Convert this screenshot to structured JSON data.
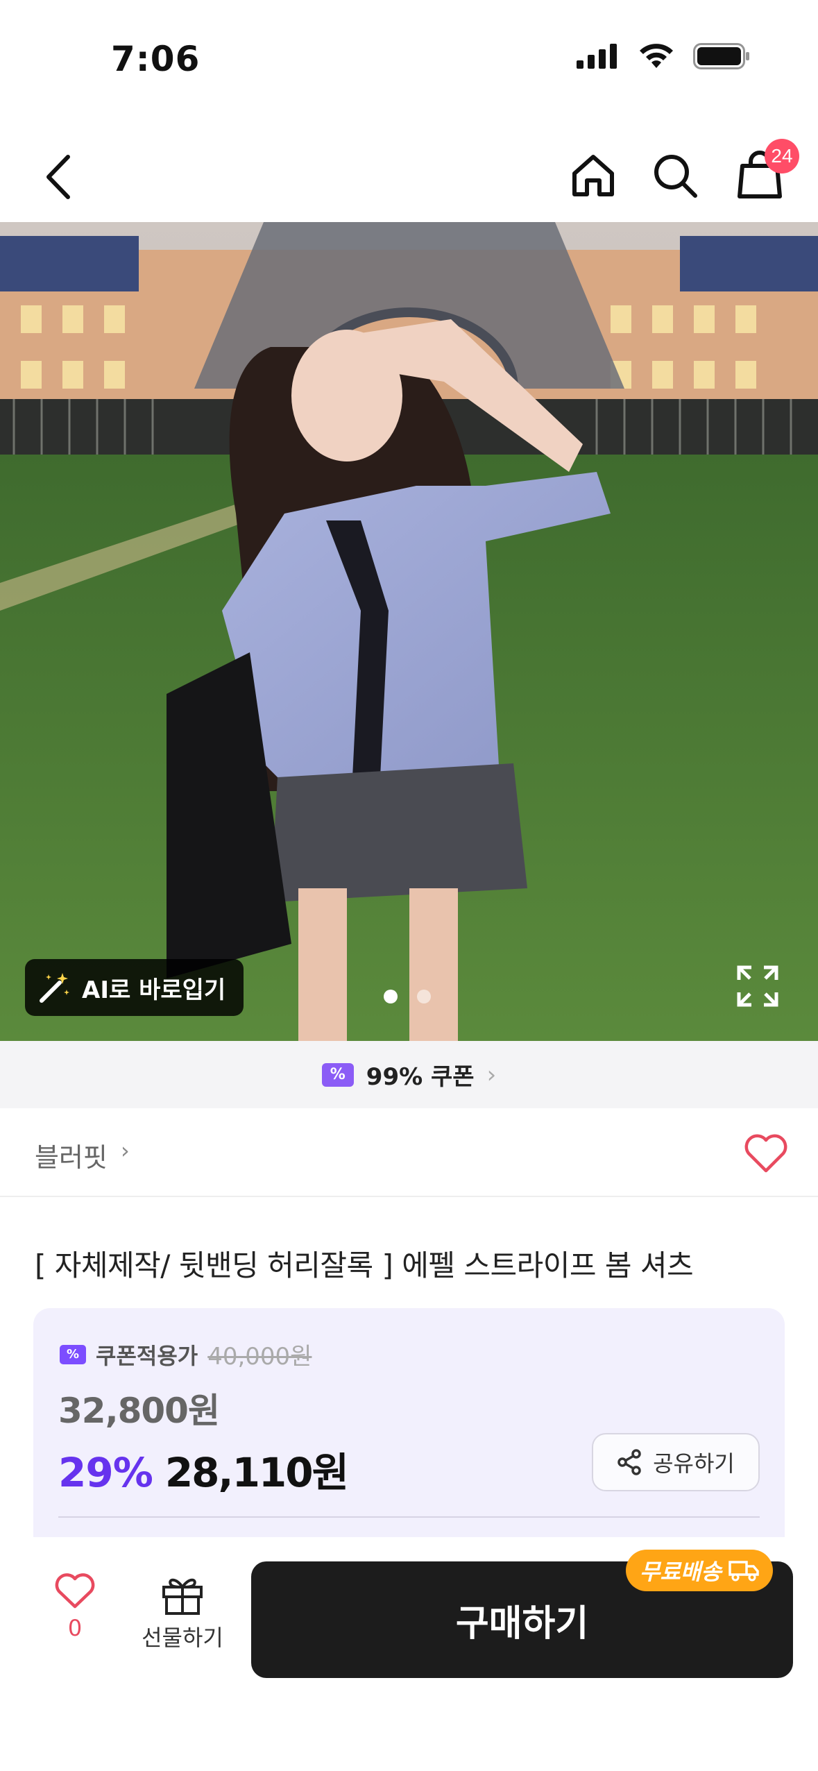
{
  "status_bar": {
    "time": "7:06"
  },
  "header": {
    "cart_count": "24"
  },
  "hero": {
    "ai_button_label": "AI로 바로입기",
    "page_total": 2,
    "page_current": 1
  },
  "coupon_bar": {
    "label": "99% 쿠폰"
  },
  "brand": {
    "name": "블러핏"
  },
  "product": {
    "title": "[ 자체제작/ 뒷밴딩 허리잘록 ] 에펠 스트라이프 봄 셔츠"
  },
  "price": {
    "coupon_label": "쿠폰적용가",
    "original_price": "40,000원",
    "sale_price": "32,800원",
    "discount_percent": "29%",
    "final_price": "28,110원",
    "share_label": "공유하기"
  },
  "bottom_bar": {
    "like_count": "0",
    "gift_label": "선물하기",
    "buy_label": "구매하기",
    "free_shipping_label": "무료배송"
  },
  "colors": {
    "accent_purple": "#6633ee",
    "badge_red": "#ff4d67",
    "free_ship_orange": "#ffa515",
    "buy_button": "#1c1c1c"
  }
}
